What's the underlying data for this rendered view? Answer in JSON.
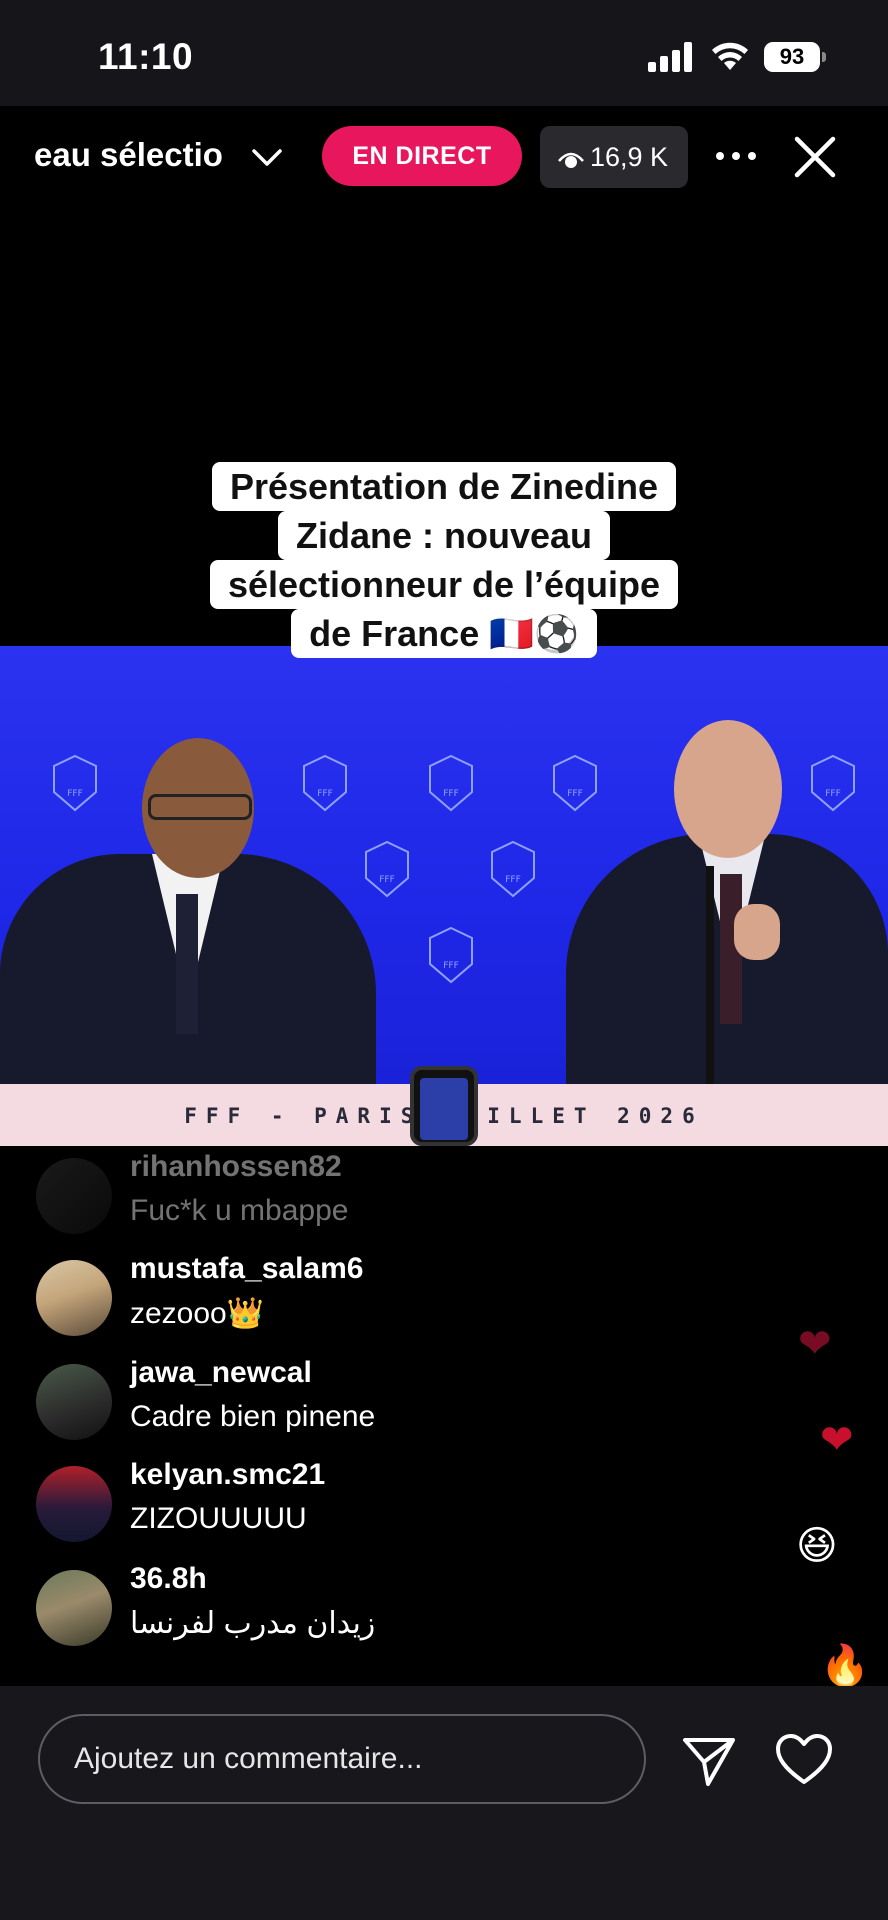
{
  "status_bar": {
    "time": "11:10",
    "battery": "93"
  },
  "live_header": {
    "channel_title": "eau sélectio",
    "live_label": "EN DIRECT",
    "viewer_count": "16,9 K",
    "icons": [
      "chevron-down-icon",
      "eye-icon",
      "more-dots-icon",
      "close-icon"
    ]
  },
  "video": {
    "caption_lines": [
      "Présentation de Zinedine",
      "Zidane : nouveau",
      "sélectionneur de l’équipe",
      "de France 🇫🇷⚽"
    ],
    "table_banner": "FFF - PARIS        JUILLET 2026",
    "logo_text": "FFF",
    "backdrop_color": "#2b33f0"
  },
  "comments": [
    {
      "username": "rihanhossen82",
      "text": "Fuc*k u mbappe"
    },
    {
      "username": "mustafa_salam6",
      "text": "zezooo👑"
    },
    {
      "username": "jawa_newcal",
      "text": "Cadre bien pinene"
    },
    {
      "username": "kelyan.smc21",
      "text": "ZIZOUUUUU"
    },
    {
      "username": "36.8h",
      "text": "زيدان مدرب لفرنسا"
    }
  ],
  "floating_reactions": [
    "❤",
    "❤",
    "😆",
    "🔥"
  ],
  "bottom_bar": {
    "comment_placeholder": "Ajoutez un commentaire...",
    "icons": [
      "send-icon",
      "heart-icon"
    ]
  },
  "colors": {
    "live_accent": "#e8175d",
    "viewer_pill": "#2a2a2e",
    "bottom_bar": "#17171c"
  }
}
